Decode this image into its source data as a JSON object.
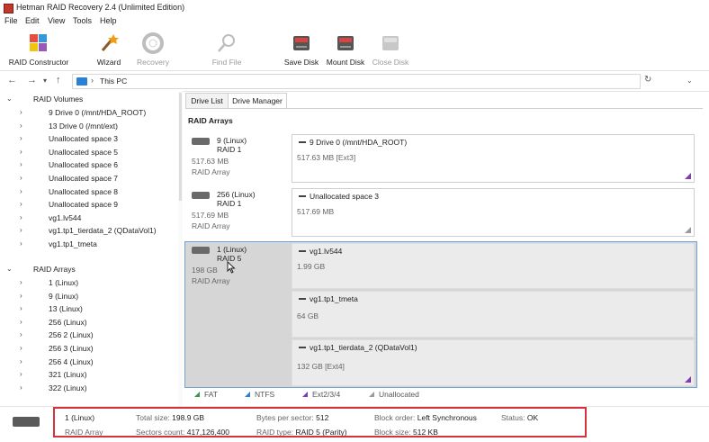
{
  "window": {
    "title": "Hetman RAID Recovery 2.4 (Unlimited Edition)"
  },
  "menu": [
    "File",
    "Edit",
    "View",
    "Tools",
    "Help"
  ],
  "toolbar": {
    "raid_constructor": "RAID Constructor",
    "wizard": "Wizard",
    "recovery": "Recovery",
    "find_file": "Find File",
    "save_disk": "Save Disk",
    "mount_disk": "Mount Disk",
    "close_disk": "Close Disk"
  },
  "address": {
    "path": "This PC"
  },
  "tree": {
    "volumes_header": "RAID Volumes",
    "volumes": [
      "9 Drive 0 (/mnt/HDA_ROOT)",
      "13 Drive 0 (/mnt/ext)",
      "Unallocated space 3",
      "Unallocated space 5",
      "Unallocated space 6",
      "Unallocated space 7",
      "Unallocated space 8",
      "Unallocated space 9",
      "vg1.lv544",
      "vg1.tp1_tierdata_2 (QDataVol1)",
      "vg1.tp1_tmeta"
    ],
    "arrays_header": "RAID Arrays",
    "arrays": [
      "1 (Linux)",
      "9 (Linux)",
      "13 (Linux)",
      "256 (Linux)",
      "256 2 (Linux)",
      "256 3 (Linux)",
      "256 4 (Linux)",
      "321 (Linux)",
      "322 (Linux)"
    ]
  },
  "tabs": [
    "Drive List",
    "Drive Manager"
  ],
  "drive_manager": {
    "section_title": "RAID Arrays",
    "arrays": [
      {
        "name": "9 (Linux)",
        "raid": "RAID 1",
        "size": "517.63 MB",
        "type": "RAID Array",
        "members": [
          {
            "name": "9 Drive 0 (/mnt/HDA_ROOT)",
            "detail": "517.63 MB [Ext3]"
          }
        ]
      },
      {
        "name": "256 (Linux)",
        "raid": "RAID 1",
        "size": "517.69 MB",
        "type": "RAID Array",
        "members": [
          {
            "name": "Unallocated space 3",
            "detail": "517.69 MB"
          }
        ]
      },
      {
        "name": "1 (Linux)",
        "raid": "RAID 5",
        "size": "198 GB",
        "type": "RAID Array",
        "members": [
          {
            "name": "vg1.lv544",
            "detail": "1.99 GB"
          },
          {
            "name": "vg1.tp1_tmeta",
            "detail": "64 GB"
          },
          {
            "name": "vg1.tp1_tierdata_2 (QDataVol1)",
            "detail": "132 GB [Ext4]"
          }
        ]
      }
    ]
  },
  "legend": [
    {
      "label": "FAT",
      "color": "#3a9a4a"
    },
    {
      "label": "NTFS",
      "color": "#2b7fd4"
    },
    {
      "label": "Ext2/3/4",
      "color": "#7b3fb0"
    },
    {
      "label": "Unallocated",
      "color": "#9a9a9a"
    }
  ],
  "status": {
    "name": "1 (Linux)",
    "type": "RAID Array",
    "total_size_label": "Total size:",
    "total_size": "198.9 GB",
    "sectors_count_label": "Sectors count:",
    "sectors_count": "417,126,400",
    "bytes_per_sector_label": "Bytes per sector:",
    "bytes_per_sector": "512",
    "raid_type_label": "RAID type:",
    "raid_type": "RAID 5 (Parity)",
    "block_order_label": "Block order:",
    "block_order": "Left Synchronous",
    "block_size_label": "Block size:",
    "block_size": "512 KB",
    "status_label": "Status:",
    "status_value": "OK"
  }
}
